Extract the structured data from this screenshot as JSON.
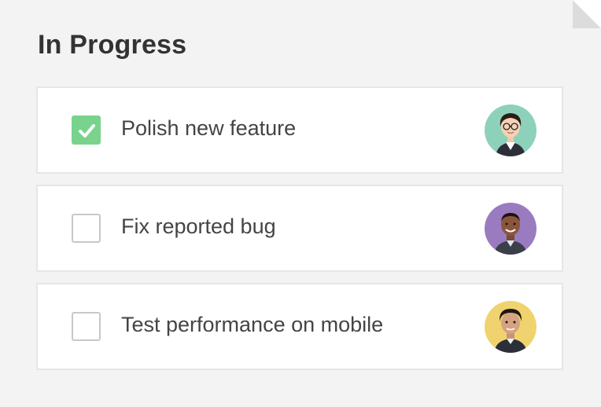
{
  "section": {
    "title": "In Progress"
  },
  "tasks": [
    {
      "label": "Polish new feature",
      "checked": true,
      "avatar_bg": "#8ed1bb",
      "avatar_icon": "person-woman-glasses-icon"
    },
    {
      "label": "Fix reported bug",
      "checked": false,
      "avatar_bg": "#9b7bbf",
      "avatar_icon": "person-man-icon"
    },
    {
      "label": "Test performance on mobile",
      "checked": false,
      "avatar_bg": "#f0d36e",
      "avatar_icon": "person-man-icon"
    }
  ],
  "colors": {
    "background": "#f3f3f3",
    "check_accent": "#7ad38c",
    "text": "#444444"
  }
}
